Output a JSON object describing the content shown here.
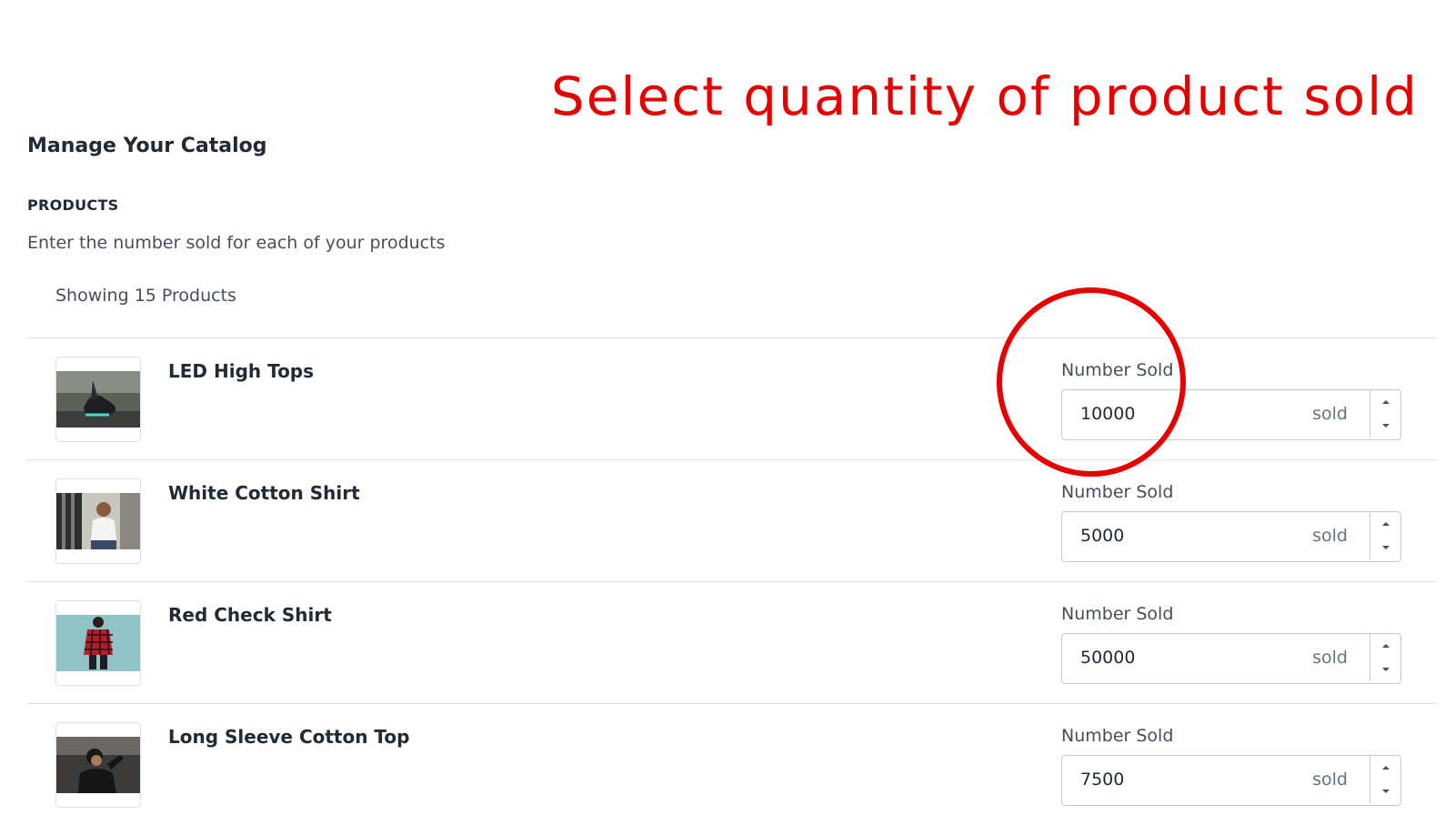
{
  "annotation": {
    "text": "Select quantity of product sold",
    "color": "#e60000"
  },
  "page": {
    "title": "Manage Your Catalog",
    "section_heading": "PRODUCTS",
    "section_description": "Enter the number sold for each of your products",
    "showing_text": "Showing 15 Products"
  },
  "products": [
    {
      "name": "LED High Tops",
      "field_label": "Number Sold",
      "value": "10000",
      "suffix": "sold",
      "image": "led-high-tops-thumbnail"
    },
    {
      "name": "White Cotton Shirt",
      "field_label": "Number Sold",
      "value": "5000",
      "suffix": "sold",
      "image": "white-cotton-shirt-thumbnail"
    },
    {
      "name": "Red Check Shirt",
      "field_label": "Number Sold",
      "value": "50000",
      "suffix": "sold",
      "image": "red-check-shirt-thumbnail"
    },
    {
      "name": "Long Sleeve Cotton Top",
      "field_label": "Number Sold",
      "value": "7500",
      "suffix": "sold",
      "image": "long-sleeve-cotton-top-thumbnail"
    }
  ],
  "icons": {
    "increment": "caret-up-icon",
    "decrement": "caret-down-icon"
  },
  "colors": {
    "text_primary": "#212b36",
    "text_secondary": "#454f5b",
    "border": "#dfe3e8",
    "highlight_circle": "#e60000"
  }
}
